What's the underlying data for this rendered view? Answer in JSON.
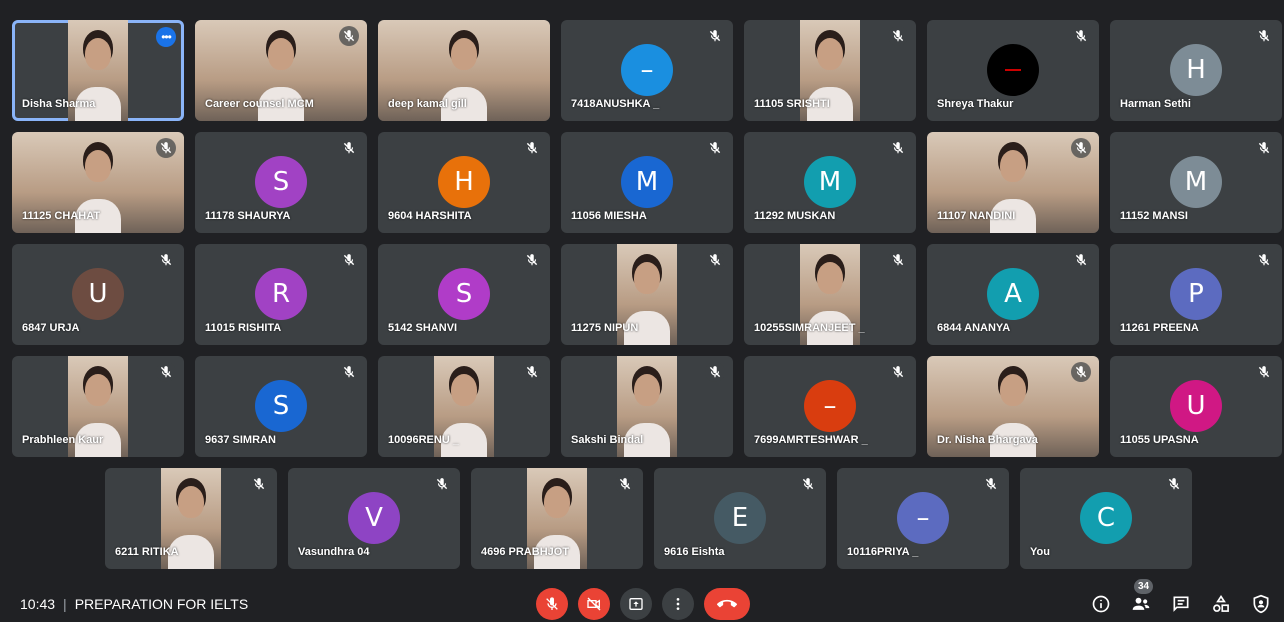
{
  "meeting": {
    "time": "10:43",
    "title": "PREPARATION FOR IELTS",
    "participant_count": "34"
  },
  "rows": [
    [
      {
        "name": "Disha Sharma",
        "type": "video",
        "active": true,
        "more": true
      },
      {
        "name": "Career counsel MCM",
        "type": "video",
        "wide": true
      },
      {
        "name": "deep kamal gill",
        "type": "video",
        "wide": true,
        "nomic": true
      },
      {
        "name": "7418ANUSHKA _",
        "type": "avatar",
        "letter": "–",
        "color": "#1a8fe0"
      },
      {
        "name": "11105 SRISHTI",
        "type": "video"
      },
      {
        "name": "Shreya Thakur",
        "type": "dark"
      },
      {
        "name": "Harman Sethi",
        "type": "avatar",
        "letter": "H",
        "color": "#7d8c96"
      }
    ],
    [
      {
        "name": "11125 CHAHAT",
        "type": "video",
        "wide": true
      },
      {
        "name": "11178 SHAURYA",
        "type": "avatar",
        "letter": "S",
        "color": "#a142c4"
      },
      {
        "name": "9604 HARSHITA",
        "type": "avatar",
        "letter": "H",
        "color": "#e8710a"
      },
      {
        "name": "11056 MIESHA",
        "type": "avatar",
        "letter": "M",
        "color": "#1967d2"
      },
      {
        "name": "11292 MUSKAN",
        "type": "avatar",
        "letter": "M",
        "color": "#129eaf"
      },
      {
        "name": "11107 NANDINI",
        "type": "video",
        "wide": true
      },
      {
        "name": "11152 MANSI",
        "type": "avatar",
        "letter": "M",
        "color": "#7d8c96"
      }
    ],
    [
      {
        "name": "6847 URJA",
        "type": "avatar",
        "letter": "U",
        "color": "#6d4c41"
      },
      {
        "name": "11015 RISHITA",
        "type": "avatar",
        "letter": "R",
        "color": "#a142c4"
      },
      {
        "name": "5142 SHANVI",
        "type": "avatar",
        "letter": "S",
        "color": "#b03cc8"
      },
      {
        "name": "11275 NIPUN",
        "type": "video"
      },
      {
        "name": "10255SIMRANJEET _",
        "type": "video"
      },
      {
        "name": "6844 ANANYA",
        "type": "avatar",
        "letter": "A",
        "color": "#129eaf"
      },
      {
        "name": "11261 PREENA",
        "type": "avatar",
        "letter": "P",
        "color": "#5c6bc0"
      }
    ],
    [
      {
        "name": "Prabhleen Kaur",
        "type": "video"
      },
      {
        "name": "9637 SIMRAN",
        "type": "avatar",
        "letter": "S",
        "color": "#1967d2"
      },
      {
        "name": "10096RENU _",
        "type": "video"
      },
      {
        "name": "Sakshi Bindal",
        "type": "video"
      },
      {
        "name": "7699AMRTESHWAR _",
        "type": "avatar",
        "letter": "–",
        "color": "#d93d0f"
      },
      {
        "name": "Dr. Nisha Bhargava",
        "type": "video",
        "wide": true
      },
      {
        "name": "11055 UPASNA",
        "type": "avatar",
        "letter": "U",
        "color": "#d01884"
      }
    ],
    [
      {
        "name": "6211 RITIKA",
        "type": "video"
      },
      {
        "name": "Vasundhra 04",
        "type": "avatar",
        "letter": "V",
        "color": "#8e44c4"
      },
      {
        "name": "4696 PRABHJOT",
        "type": "video"
      },
      {
        "name": "9616 Eishta",
        "type": "avatar",
        "letter": "E",
        "color": "#455a64"
      },
      {
        "name": "10116PRIYA _",
        "type": "avatar",
        "letter": "–",
        "color": "#5c6bc0"
      },
      {
        "name": "You",
        "type": "avatar",
        "letter": "C",
        "color": "#129eaf"
      }
    ]
  ],
  "icons": {
    "mic_off": "mic-off-icon",
    "camera_off": "camera-off-icon",
    "present": "present-icon",
    "more": "more-options-icon",
    "end_call": "end-call-icon",
    "info": "info-icon",
    "people": "people-icon",
    "chat": "chat-icon",
    "activities": "activities-icon",
    "host_controls": "host-controls-icon"
  },
  "colors": {
    "end_call": "#ea4335",
    "active_outline": "#8ab4f8"
  }
}
